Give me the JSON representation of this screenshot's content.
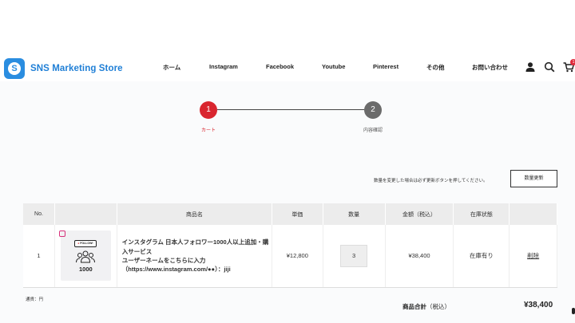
{
  "header": {
    "logo_text": "SNS Marketing Store",
    "logo_letter": "S",
    "brand_color": "#1f7fd6",
    "nav": [
      "ホーム",
      "Instagram",
      "Facebook",
      "Youtube",
      "Pinterest",
      "その他",
      "お問い合わせ"
    ],
    "icons": [
      "user-icon",
      "search-icon",
      "cart-icon"
    ],
    "cart_count": "1"
  },
  "steps": {
    "step1_num": "1",
    "step1_label": "カート",
    "step2_num": "2",
    "step2_label": "内容確認",
    "active_color": "#d9262f"
  },
  "notice": "数量を変更した場合は必ず更新ボタンを押してください。",
  "update_button": "数量更新",
  "table": {
    "headers": [
      "No.",
      "",
      "商品名",
      "単価",
      "数量",
      "金額（税込）",
      "在庫状態",
      ""
    ],
    "rows": [
      {
        "no": "1",
        "thumb_follow": "FOLLOW!",
        "thumb_count": "1000",
        "name": "インスタグラム 日本人フォロワー1000人以上追加・購入サービス\nユーザーネームをこちらに入力（https://www.instagram.com/●●）：jiji",
        "price": "¥12,800",
        "qty": "3",
        "amount": "¥38,400",
        "stock": "在庫有り",
        "delete": "削除"
      }
    ]
  },
  "currency_note": "通貨：円",
  "total": {
    "label": "商品合計",
    "tax_note": "（税込）",
    "value": "¥38,400"
  }
}
